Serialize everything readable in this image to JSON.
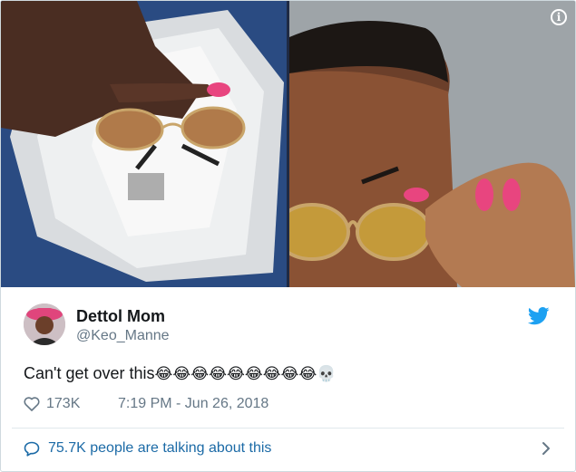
{
  "colors": {
    "brand_blue": "#1da1f2",
    "link_blue": "#1b6aa6",
    "text_dark": "#14171a",
    "text_gray": "#657786",
    "border": "#cfd9de"
  },
  "media": {
    "left_photo": "photo",
    "right_photo": "photo",
    "info_icon": "info-icon"
  },
  "author": {
    "display_name": "Dettol Mom",
    "handle": "@Keo_Manne",
    "avatar_icon": "avatar"
  },
  "tweet": {
    "text": "Can't get over this",
    "emojis": "😂😂😂😂😂😂😂😂😂💀"
  },
  "meta": {
    "like_count": "173K",
    "timestamp": "7:19 PM - Jun 26, 2018",
    "heart_icon": "heart-icon"
  },
  "footer": {
    "talking": "75.7K people are talking about this",
    "bubble_icon": "speech-bubble-icon",
    "chevron_icon": "chevron-right-icon"
  },
  "brand_icon": "twitter-bird-icon"
}
